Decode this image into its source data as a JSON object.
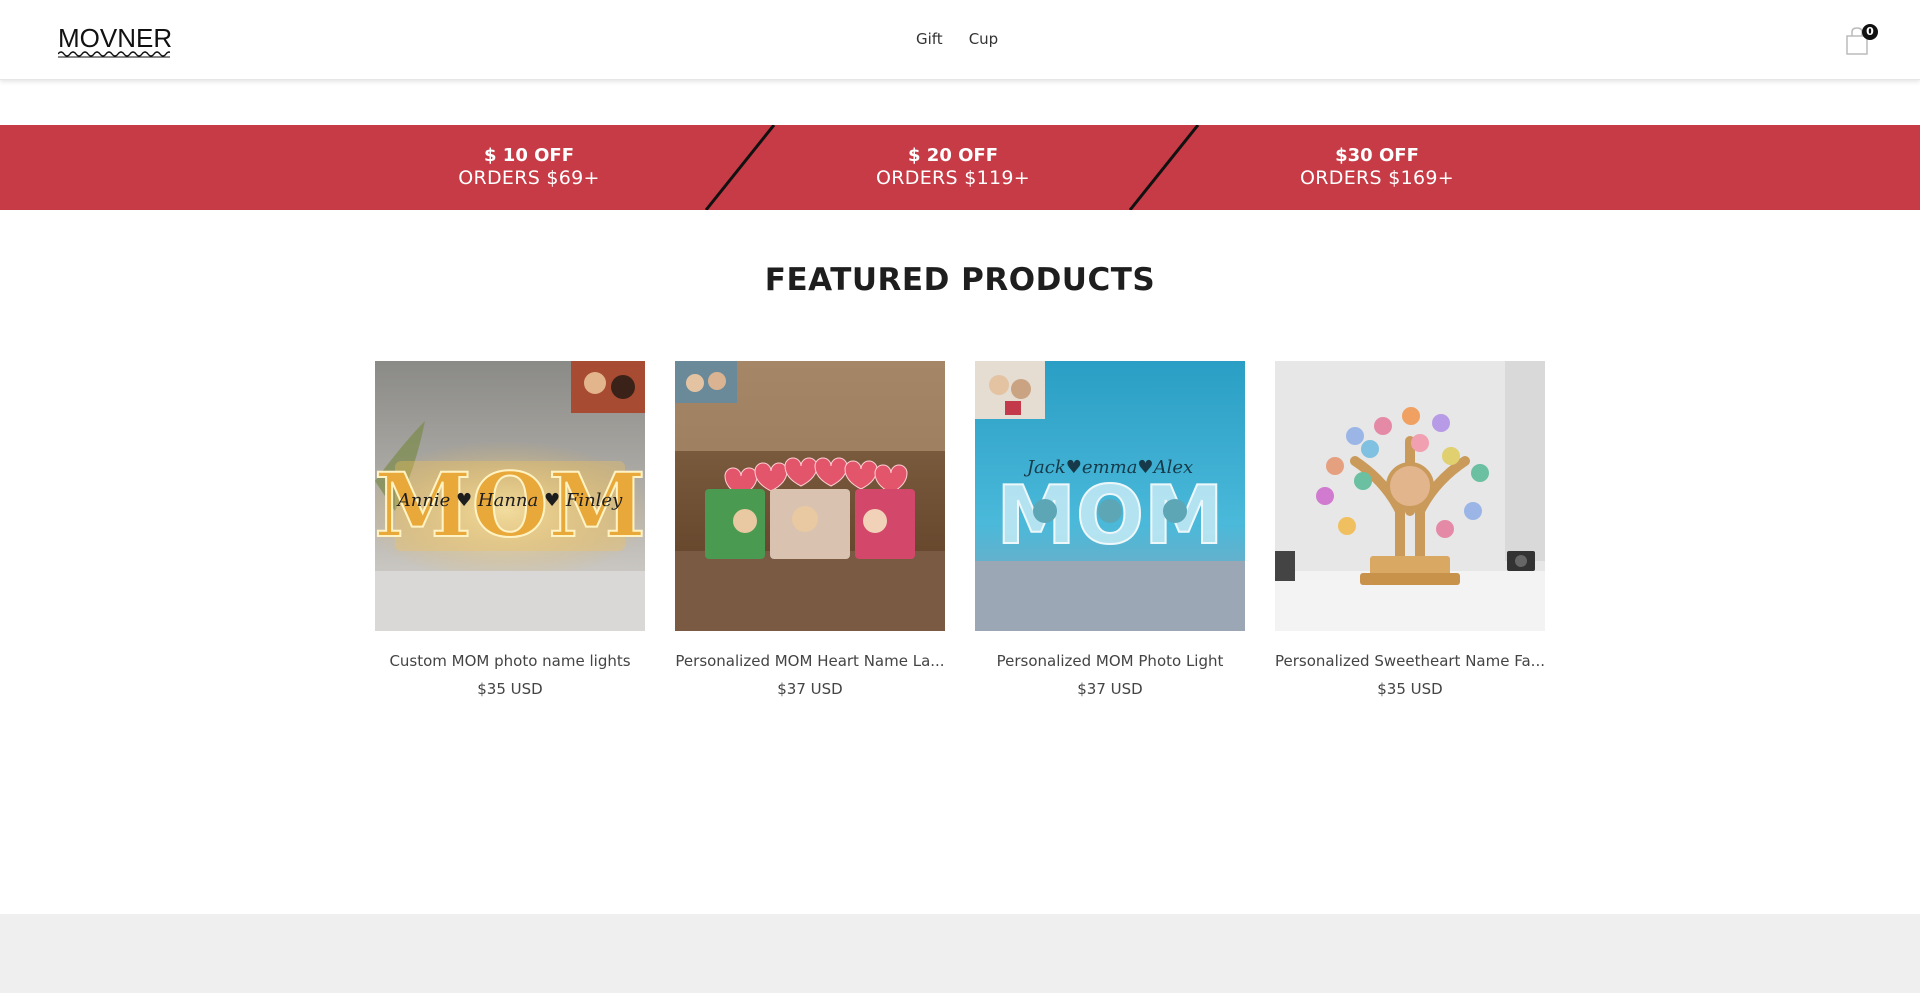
{
  "header": {
    "logo": "MOVNER",
    "nav": [
      "Gift",
      "Cup"
    ],
    "cart_count": "0"
  },
  "promo": [
    {
      "top": "$ 10 OFF",
      "bottom": "ORDERS $69+"
    },
    {
      "top": "$ 20 OFF",
      "bottom": "ORDERS $119+"
    },
    {
      "top": "$30 OFF",
      "bottom": "ORDERS $169+"
    }
  ],
  "featured": {
    "title": "FEATURED PRODUCTS",
    "products": [
      {
        "name": "Custom MOM photo name lights",
        "price": "$35 USD",
        "image": "mom-letters-photo-lamp"
      },
      {
        "name": "Personalized MOM Heart Name La...",
        "price": "$37 USD",
        "image": "mom-heart-name-lamp"
      },
      {
        "name": "Personalized MOM Photo Light",
        "price": "$37 USD",
        "image": "mom-photo-light-blue"
      },
      {
        "name": "Personalized Sweetheart Name Fa...",
        "price": "$35 USD",
        "image": "family-tree-hearts"
      }
    ]
  },
  "colors": {
    "promo_bg": "#c63b45",
    "footer_bg": "#efefef"
  }
}
